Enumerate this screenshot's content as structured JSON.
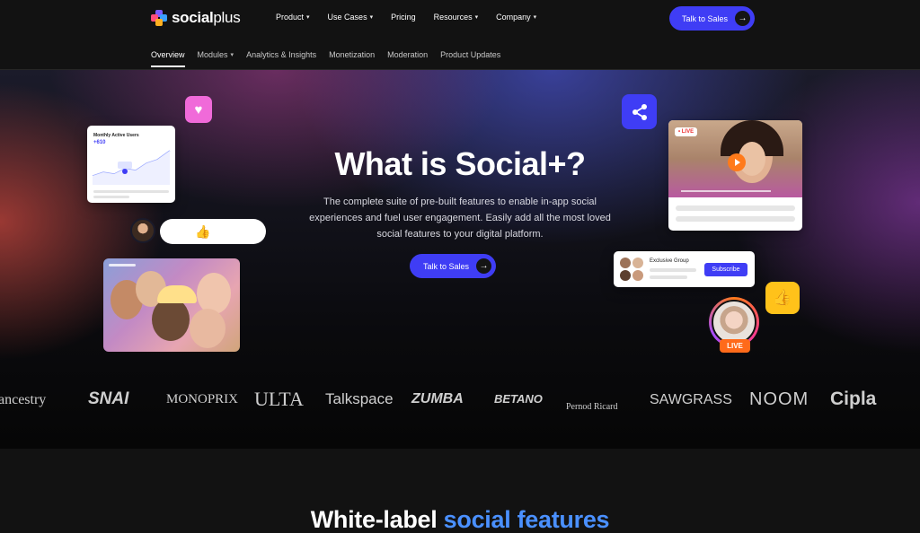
{
  "brand": {
    "name_bold": "social",
    "name_thin": "plus"
  },
  "nav": {
    "menu": [
      {
        "label": "Product",
        "dropdown": true
      },
      {
        "label": "Use Cases",
        "dropdown": true
      },
      {
        "label": "Pricing",
        "dropdown": false
      },
      {
        "label": "Resources",
        "dropdown": true
      },
      {
        "label": "Company",
        "dropdown": true
      }
    ],
    "cta_label": "Talk to Sales"
  },
  "subnav": {
    "items": [
      {
        "label": "Overview",
        "active": true,
        "dropdown": false
      },
      {
        "label": "Modules",
        "active": false,
        "dropdown": true
      },
      {
        "label": "Analytics & Insights",
        "active": false,
        "dropdown": false
      },
      {
        "label": "Monetization",
        "active": false,
        "dropdown": false
      },
      {
        "label": "Moderation",
        "active": false,
        "dropdown": false
      },
      {
        "label": "Product Updates",
        "active": false,
        "dropdown": false
      }
    ]
  },
  "hero": {
    "title": "What is Social+?",
    "subtitle": "The complete suite of pre-built features to enable in-app social experiences and fuel user engagement. Easily add all the most loved social features to your digital platform.",
    "cta_label": "Talk to Sales"
  },
  "widgets": {
    "mau_title": "Monthly Active Users",
    "mau_value": "+610",
    "reactions": [
      "😂",
      "😍",
      "👍",
      "😞",
      "😠"
    ],
    "live_tag": "• LIVE",
    "group_title": "Exclusive Group",
    "subscribe_label": "Subscribe",
    "live_label": "LIVE"
  },
  "logos": [
    "ancestry",
    "SNAI",
    "MONOPRIX",
    "ULTA",
    "Talkspace",
    "ZUMBA",
    "BETANO",
    "Pernod Ricard",
    "SAWGRASS",
    "NOOM",
    "Cipla"
  ],
  "section": {
    "title_plain": "White-label",
    "title_accent": "social features"
  },
  "colors": {
    "accent": "#3f3df5",
    "heart": "#f06ad9",
    "thumb": "#ffc21a",
    "live": "#ff6a1a",
    "link_blue": "#4a90ff"
  }
}
